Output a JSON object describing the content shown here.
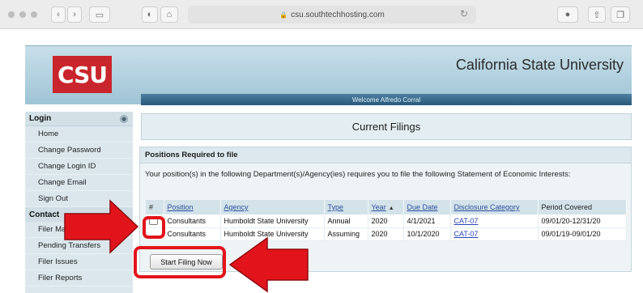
{
  "browser": {
    "url": "csu.southtechhosting.com",
    "back_icon": "chevron-left-icon",
    "forward_icon": "chevron-right-icon"
  },
  "header": {
    "logo_text": "CSU",
    "university_name": "California State University",
    "welcome_text": "Welcome Alfredo Corral"
  },
  "sidebar": {
    "login_title": "Login",
    "login_items": [
      "Home",
      "Change Password",
      "Change Login ID",
      "Change Email",
      "Sign Out"
    ],
    "contact_title": "Contact",
    "contact_items": [
      "Filer Management",
      "Pending Transfers",
      "Filer Issues",
      "Filer Reports"
    ]
  },
  "main": {
    "title": "Current Filings",
    "panel_title": "Positions Required to file",
    "panel_text": "Your position(s) in the following Department(s)/Agency(ies) requires you to file the following Statement of Economic Interests:",
    "columns": [
      "#",
      "Position",
      "Agency",
      "Type",
      "Year",
      "Due Date",
      "Disclosure Category",
      "Period Covered"
    ],
    "rows": [
      {
        "position": "Consultants",
        "agency": "Humboldt State University",
        "type": "Annual",
        "year": "2020",
        "due_date": "4/1/2021",
        "category": "CAT-07",
        "period": "09/01/20-12/31/20"
      },
      {
        "position": "Consultants",
        "agency": "Humboldt State University",
        "type": "Assuming",
        "year": "2020",
        "due_date": "10/1/2020",
        "category": "CAT-07",
        "period": "09/01/19-09/01/20"
      }
    ],
    "start_button": "Start Filing Now"
  },
  "colors": {
    "brand_red": "#c9252c",
    "annotation_red": "#e2141b",
    "header_blue": "#27587b"
  }
}
